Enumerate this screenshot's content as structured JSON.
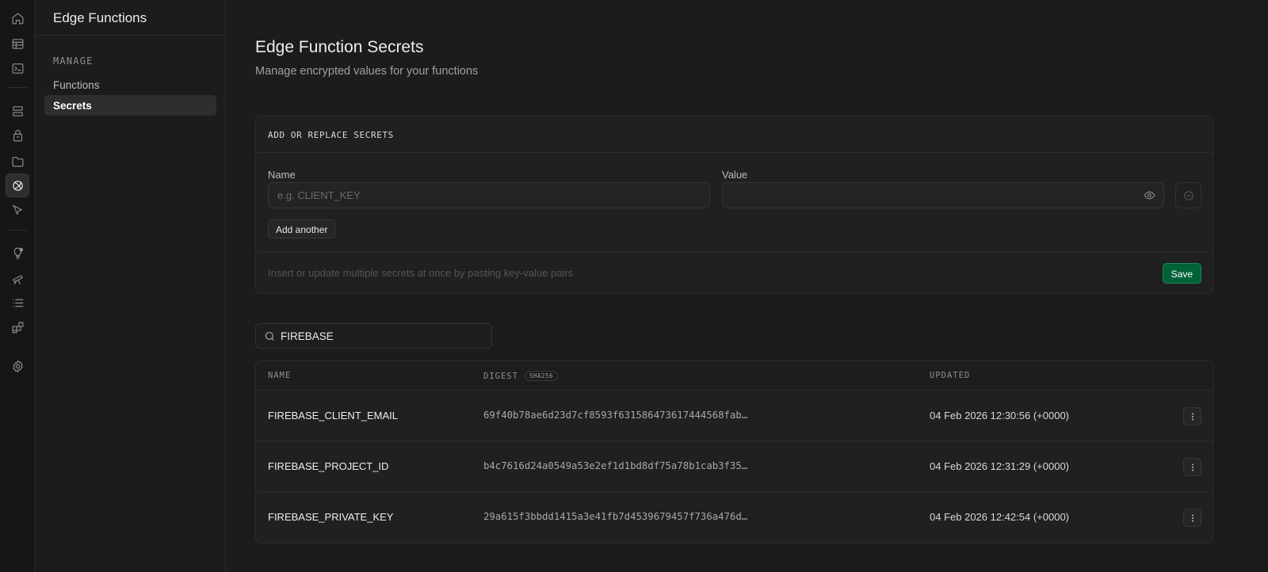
{
  "sidebar": {
    "title": "Edge Functions",
    "section": "MANAGE",
    "items": [
      {
        "label": "Functions"
      },
      {
        "label": "Secrets"
      }
    ]
  },
  "rail": {
    "icons": [
      "home-icon",
      "table-editor-icon",
      "sql-editor-icon",
      "database-icon",
      "auth-icon",
      "storage-icon",
      "edge-functions-icon",
      "realtime-icon",
      "advisors-icon",
      "reports-icon",
      "logs-icon",
      "integrations-icon",
      "settings-icon"
    ]
  },
  "page": {
    "title": "Edge Function Secrets",
    "subtitle": "Manage encrypted values for your functions"
  },
  "form": {
    "heading": "ADD OR REPLACE SECRETS",
    "name_label": "Name",
    "name_placeholder": "e.g. CLIENT_KEY",
    "value_label": "Value",
    "value_value": "",
    "add_label": "Add another",
    "hint": "Insert or update multiple secrets at once by pasting key-value pairs",
    "save_label": "Save"
  },
  "search": {
    "value": "FIREBASE"
  },
  "table": {
    "headers": {
      "name": "NAME",
      "digest": "DIGEST",
      "digest_badge": "SHA256",
      "updated": "UPDATED"
    },
    "rows": [
      {
        "name": "FIREBASE_CLIENT_EMAIL",
        "digest": "69f40b78ae6d23d7cf8593f631586473617444568fab…",
        "updated": "04 Feb 2026 12:30:56 (+0000)"
      },
      {
        "name": "FIREBASE_PROJECT_ID",
        "digest": "b4c7616d24a0549a53e2ef1d1bd8df75a78b1cab3f35…",
        "updated": "04 Feb 2026 12:31:29 (+0000)"
      },
      {
        "name": "FIREBASE_PRIVATE_KEY",
        "digest": "29a615f3bbdd1415a3e41fb7d4539679457f736a476d…",
        "updated": "04 Feb 2026 12:42:54 (+0000)"
      }
    ]
  },
  "colors": {
    "background": "#1c1c1c",
    "accent": "#006239"
  }
}
